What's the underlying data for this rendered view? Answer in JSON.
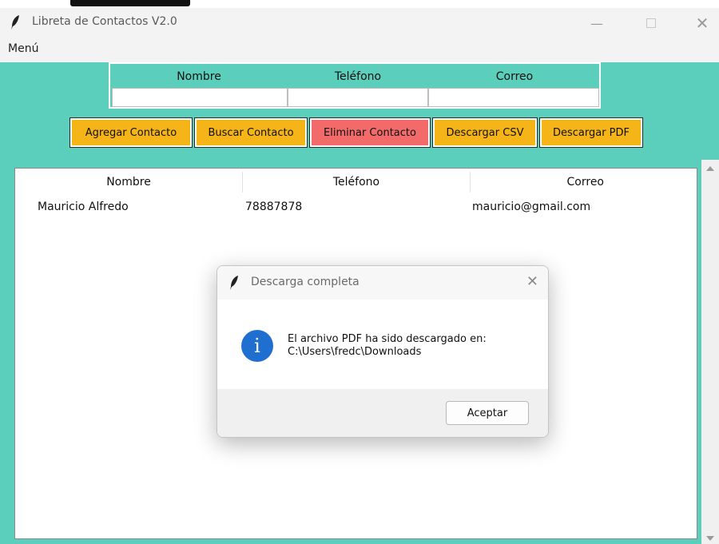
{
  "window": {
    "title": "Libreta de Contactos V2.0"
  },
  "menu": {
    "items": [
      "Menú"
    ]
  },
  "form": {
    "labels": [
      "Nombre",
      "Teléfono",
      "Correo"
    ],
    "values": [
      "",
      "",
      ""
    ]
  },
  "buttons": {
    "add": "Agregar Contacto",
    "search": "Buscar Contacto",
    "delete": "Eliminar Contacto",
    "csv": "Descargar CSV",
    "pdf": "Descargar PDF"
  },
  "table": {
    "columns": [
      "Nombre",
      "Teléfono",
      "Correo"
    ],
    "rows": [
      [
        "Mauricio Alfredo",
        "78887878",
        "mauricio@gmail.com"
      ]
    ]
  },
  "dialog": {
    "title": "Descarga completa",
    "message_line1": "El archivo PDF ha sido descargado en:",
    "message_line2": "C:\\Users\\fredc\\Downloads",
    "ok_label": "Aceptar"
  },
  "icons": {
    "app": "feather-icon",
    "info": "info-icon",
    "minimize": "minimize-icon",
    "maximize": "maximize-icon",
    "close": "close-icon"
  },
  "colors": {
    "background": "#5bcfbb",
    "button": "#f5b418",
    "button_delete": "#f26a6a",
    "info": "#1f6fd1"
  }
}
